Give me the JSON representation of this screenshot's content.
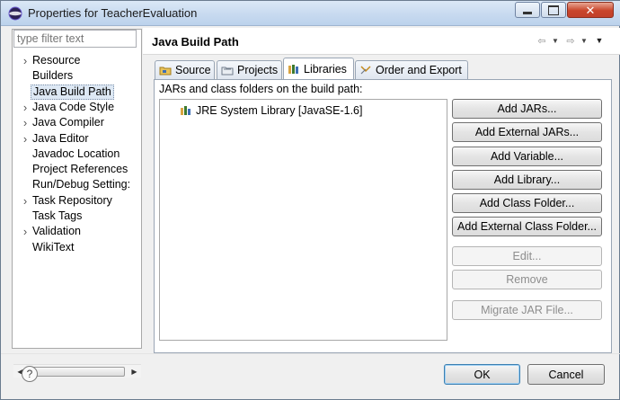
{
  "window": {
    "title": "Properties for TeacherEvaluation",
    "controls": [
      "minimize-icon",
      "maximize-icon",
      "close-icon"
    ]
  },
  "sidebar": {
    "filter_placeholder": "type filter text",
    "items": [
      {
        "label": "Resource",
        "expandable": true
      },
      {
        "label": "Builders",
        "expandable": false
      },
      {
        "label": "Java Build Path",
        "expandable": false,
        "selected": true
      },
      {
        "label": "Java Code Style",
        "expandable": true
      },
      {
        "label": "Java Compiler",
        "expandable": true
      },
      {
        "label": "Java Editor",
        "expandable": true
      },
      {
        "label": "Javadoc Location",
        "expandable": false
      },
      {
        "label": "Project References",
        "expandable": false
      },
      {
        "label": "Run/Debug Setting:",
        "expandable": false
      },
      {
        "label": "Task Repository",
        "expandable": true
      },
      {
        "label": "Task Tags",
        "expandable": false
      },
      {
        "label": "Validation",
        "expandable": true
      },
      {
        "label": "WikiText",
        "expandable": false
      }
    ]
  },
  "header": {
    "title": "Java Build Path",
    "nav_icons": [
      "back-arrow-icon",
      "back-menu-icon",
      "forward-arrow-icon",
      "forward-menu-icon",
      "view-menu-icon"
    ]
  },
  "tabs": [
    {
      "label": "Source",
      "icon": "source-folder-icon",
      "active": false
    },
    {
      "label": "Projects",
      "icon": "projects-icon",
      "active": false
    },
    {
      "label": "Libraries",
      "icon": "libraries-icon",
      "active": true
    },
    {
      "label": "Order and Export",
      "icon": "order-export-icon",
      "active": false
    }
  ],
  "libraries": {
    "section_label": "JARs and class folders on the build path:",
    "items": [
      {
        "label": "JRE System Library [JavaSE-1.6]",
        "icon": "library-icon"
      }
    ]
  },
  "buttons": [
    {
      "label": "Add JARs...",
      "enabled": true
    },
    {
      "label": "Add External JARs...",
      "enabled": true
    },
    {
      "label": "Add Variable...",
      "enabled": true
    },
    {
      "label": "Add Library...",
      "enabled": true
    },
    {
      "label": "Add Class Folder...",
      "enabled": true
    },
    {
      "label": "Add External Class Folder...",
      "enabled": true
    },
    {
      "label": "Edit...",
      "enabled": false
    },
    {
      "label": "Remove",
      "enabled": false
    },
    {
      "label": "Migrate JAR File...",
      "enabled": false
    }
  ],
  "footer": {
    "help_label": "?",
    "ok_label": "OK",
    "cancel_label": "Cancel"
  },
  "colors": {
    "selection": "#dde8f4",
    "titlebar": "#c6d9ef",
    "library_icon": "#3d7a2f"
  }
}
